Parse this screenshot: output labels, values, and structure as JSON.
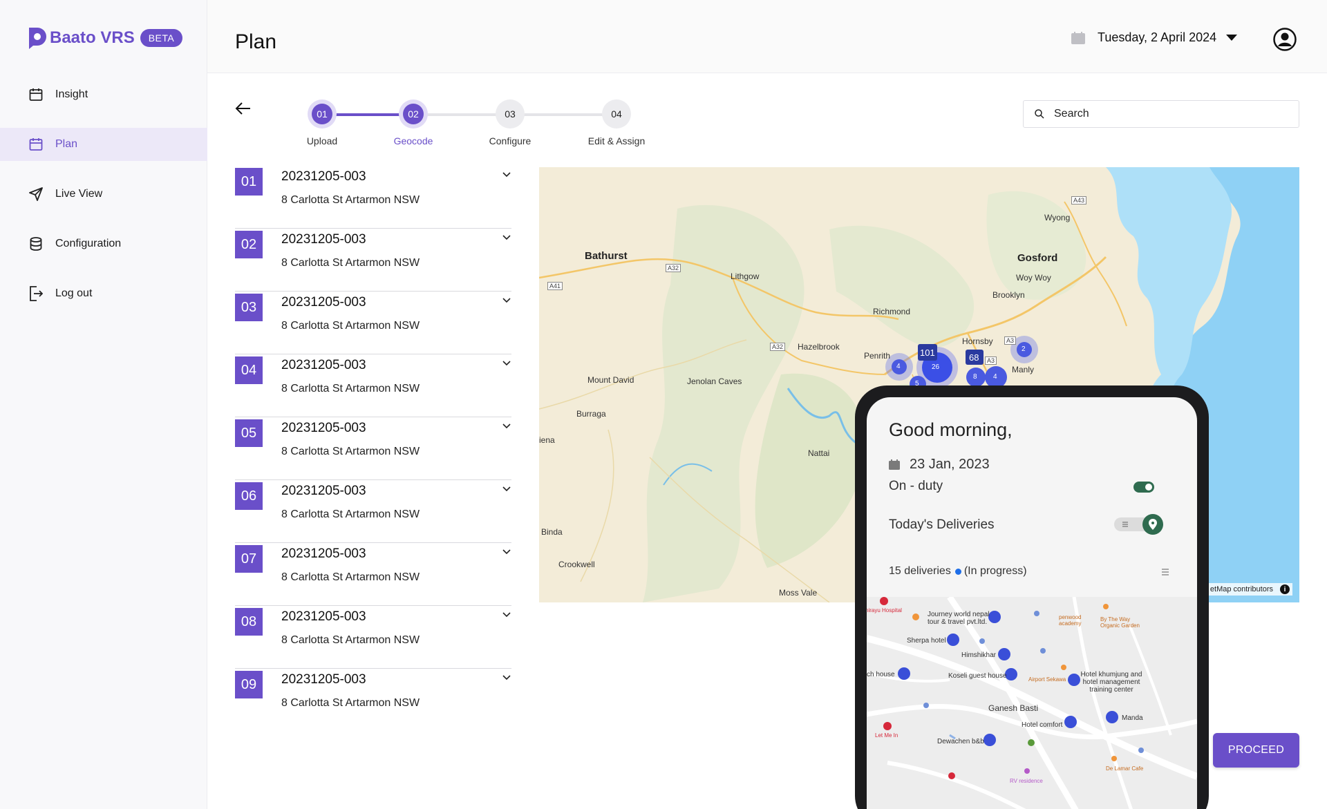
{
  "app": {
    "brand": "Baato VRS",
    "badge": "BETA",
    "brand_color": "#6a4fc9"
  },
  "sidebar": {
    "items": [
      {
        "label": "Insight",
        "icon": "calendar-icon",
        "active": false
      },
      {
        "label": "Plan",
        "icon": "calendar-icon",
        "active": true
      },
      {
        "label": "Live View",
        "icon": "send-icon",
        "active": false
      },
      {
        "label": "Configuration",
        "icon": "database-icon",
        "active": false
      },
      {
        "label": "Log out",
        "icon": "logout-icon",
        "active": false
      }
    ]
  },
  "header": {
    "title": "Plan",
    "date": "Tuesday, 2 April 2024"
  },
  "stepper": {
    "steps": [
      {
        "num": "01",
        "label": "Upload",
        "state": "done"
      },
      {
        "num": "02",
        "label": "Geocode",
        "state": "current"
      },
      {
        "num": "03",
        "label": "Configure",
        "state": "pending"
      },
      {
        "num": "04",
        "label": "Edit & Assign",
        "state": "pending"
      }
    ]
  },
  "search": {
    "placeholder": "Search"
  },
  "list": {
    "items": [
      {
        "num": "01",
        "code": "20231205-003",
        "address": "8 Carlotta St Artarmon NSW"
      },
      {
        "num": "02",
        "code": "20231205-003",
        "address": "8 Carlotta St Artarmon NSW"
      },
      {
        "num": "03",
        "code": "20231205-003",
        "address": "8 Carlotta St Artarmon NSW"
      },
      {
        "num": "04",
        "code": "20231205-003",
        "address": "8 Carlotta St Artarmon NSW"
      },
      {
        "num": "05",
        "code": "20231205-003",
        "address": "8 Carlotta St Artarmon NSW"
      },
      {
        "num": "06",
        "code": "20231205-003",
        "address": "8 Carlotta St Artarmon NSW"
      },
      {
        "num": "07",
        "code": "20231205-003",
        "address": "8 Carlotta St Artarmon NSW"
      },
      {
        "num": "08",
        "code": "20231205-003",
        "address": "8 Carlotta St Artarmon NSW"
      },
      {
        "num": "09",
        "code": "20231205-003",
        "address": "8 Carlotta St Artarmon NSW"
      }
    ]
  },
  "map": {
    "attribution": "etMap contributors",
    "places": [
      "Bathurst",
      "Lithgow",
      "Gosford",
      "Wyong",
      "Woy Woy",
      "Brooklyn",
      "Richmond",
      "Hazelbrook",
      "Penrith",
      "Hornsby",
      "Manly",
      "Mount David",
      "Jenolan Caves",
      "Burraga",
      "iena",
      "Nattai",
      "Binda",
      "Crookwell",
      "Moss Vale"
    ],
    "roads": [
      "A32",
      "A41",
      "A43",
      "A32",
      "A3",
      "A3"
    ],
    "clusters": [
      "101",
      "26",
      "68",
      "4",
      "2",
      "8",
      "4",
      "5"
    ]
  },
  "phone": {
    "greeting": "Good morning,",
    "date": "23 Jan, 2023",
    "on_duty": "On - duty",
    "todays": "Today's Deliveries",
    "count": "15 deliveries",
    "status": "(In progress)",
    "map_labels": [
      "Journey world nepal tour & travel pvt.ltd.",
      "Sherpa hotel",
      "Himshikhar",
      "ch house",
      "Koseli guest house",
      "Hotel khumjung and hotel management training center",
      "Ganesh Basti",
      "Hotel comfort",
      "Manda",
      "Dewachen b&b",
      "penwood academy",
      "By The Way Organic Garden",
      "Airport Sekawa",
      "Let Me In",
      "De Lamar Cafe",
      "RV residence",
      "hirayu Hospital"
    ]
  },
  "actions": {
    "proceed": "PROCEED"
  }
}
